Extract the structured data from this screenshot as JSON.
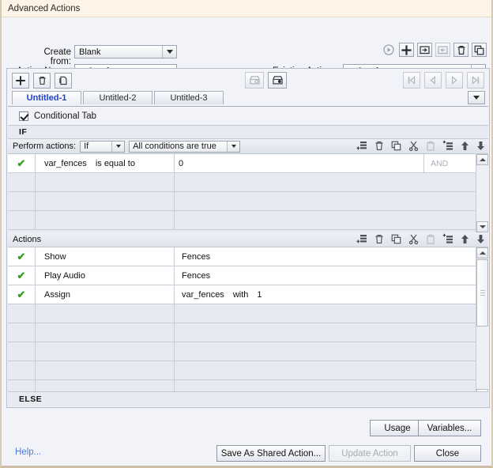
{
  "window": {
    "title": "Advanced Actions"
  },
  "form": {
    "create_from_label": "Create from:",
    "create_from_value": "Blank",
    "action_name_label": "Action Name:",
    "action_name_value": "action_fences",
    "action_name_placeholder": "",
    "existing_actions_label": "Existing Actions:",
    "existing_actions_value": "action_fences"
  },
  "top_toolbar": {
    "items": [
      {
        "name": "preview-action-button",
        "icon": "play-icon",
        "enabled": false
      },
      {
        "name": "add-action-button",
        "icon": "plus-icon",
        "enabled": true
      },
      {
        "name": "import-action-button",
        "icon": "import-icon",
        "enabled": true
      },
      {
        "name": "export-action-button",
        "icon": "export-icon",
        "enabled": false
      },
      {
        "name": "delete-action-button",
        "icon": "trash-icon",
        "enabled": true
      },
      {
        "name": "duplicate-action-button",
        "icon": "duplicate-icon",
        "enabled": true
      }
    ]
  },
  "panel_toolbar": {
    "left": [
      {
        "name": "add-tab-button",
        "icon": "plus-icon",
        "enabled": true
      },
      {
        "name": "delete-tab-button",
        "icon": "trash-icon",
        "enabled": true
      },
      {
        "name": "duplicate-tab-button",
        "icon": "duplicate-icon",
        "enabled": true
      }
    ],
    "middle": [
      {
        "name": "save-decision-button",
        "icon": "archive-out-icon",
        "enabled": false
      },
      {
        "name": "load-decision-button",
        "icon": "archive-in-icon",
        "enabled": true
      }
    ],
    "right": [
      {
        "name": "first-tab-button",
        "icon": "first-icon",
        "enabled": false
      },
      {
        "name": "previous-tab-button",
        "icon": "previous-icon",
        "enabled": false
      },
      {
        "name": "next-tab-button",
        "icon": "next-icon",
        "enabled": false
      },
      {
        "name": "last-tab-button",
        "icon": "last-icon",
        "enabled": false
      }
    ]
  },
  "tabs": {
    "items": [
      {
        "label": "Untitled-1",
        "active": true
      },
      {
        "label": "Untitled-2",
        "active": false
      },
      {
        "label": "Untitled-3",
        "active": false
      }
    ]
  },
  "conditional": {
    "checkbox_label": "Conditional Tab",
    "checked": true,
    "if_label": "IF",
    "else_label": "ELSE"
  },
  "conditions": {
    "perform_actions_label": "Perform actions:",
    "perform_value": "If",
    "match_value": "All conditions are true",
    "rows": [
      {
        "enabled": true,
        "left": "var_fences",
        "operator": "is equal to",
        "right": "0",
        "join": "AND"
      }
    ],
    "empty_row_count": 3,
    "toolbar": [
      {
        "name": "add-condition-icon",
        "enabled": true
      },
      {
        "name": "delete-condition-icon",
        "enabled": true
      },
      {
        "name": "copy-condition-icon",
        "enabled": true
      },
      {
        "name": "cut-condition-icon",
        "enabled": true
      },
      {
        "name": "paste-condition-icon",
        "enabled": false
      },
      {
        "name": "insert-condition-icon",
        "enabled": true
      },
      {
        "name": "move-condition-up-icon",
        "enabled": true
      },
      {
        "name": "move-condition-down-icon",
        "enabled": true
      }
    ]
  },
  "actions": {
    "header_label": "Actions",
    "rows": [
      {
        "enabled": true,
        "action": "Show",
        "param": "Fences",
        "param2": "",
        "param3": ""
      },
      {
        "enabled": true,
        "action": "Play Audio",
        "param": "Fences",
        "param2": "",
        "param3": ""
      },
      {
        "enabled": true,
        "action": "Assign",
        "param": "var_fences",
        "param2": "with",
        "param3": "1"
      }
    ],
    "empty_row_count": 5,
    "toolbar": [
      {
        "name": "add-action-row-icon",
        "enabled": true
      },
      {
        "name": "delete-action-row-icon",
        "enabled": true
      },
      {
        "name": "copy-action-row-icon",
        "enabled": true
      },
      {
        "name": "cut-action-row-icon",
        "enabled": true
      },
      {
        "name": "paste-action-row-icon",
        "enabled": false
      },
      {
        "name": "insert-action-row-icon",
        "enabled": true
      },
      {
        "name": "move-action-up-icon",
        "enabled": true
      },
      {
        "name": "move-action-down-icon",
        "enabled": true
      }
    ]
  },
  "footer": {
    "help_label": "Help...",
    "usage_label": "Usage",
    "variables_label": "Variables...",
    "save_shared_label": "Save As Shared Action...",
    "update_action_label": "Update Action",
    "update_action_enabled": false,
    "close_label": "Close"
  },
  "colors": {
    "titlebar_bg": "#fdf3e7",
    "panel_bg": "#f1f3f8",
    "grid_empty_row": "#e7eaf1",
    "grid_filled_row": "#ffffff",
    "active_tab_text": "#1d3fd0",
    "link": "#4a7ddb",
    "check_green": "#3a9e21",
    "window_border": "#d8cbb4"
  }
}
